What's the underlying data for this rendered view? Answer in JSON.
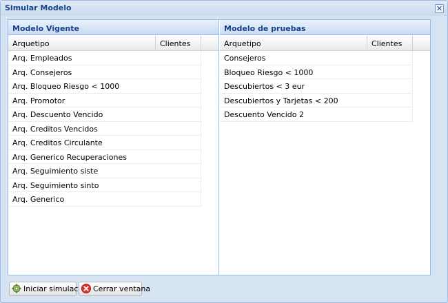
{
  "window": {
    "title": "Simular Modelo",
    "close_glyph": "✕"
  },
  "left_panel": {
    "title": "Modelo Vigente",
    "columns": [
      "Arquetipo",
      "Clientes"
    ],
    "rows": [
      "Arq. Empleados",
      "Arq. Consejeros",
      "Arq. Bloqueo Riesgo < 1000",
      "Arq. Promotor",
      "Arq. Descuento Vencido",
      "Arq. Creditos Vencidos",
      "Arq. Creditos Circulante",
      "Arq. Generico Recuperaciones",
      "Arq. Seguimiento siste",
      "Arq. Seguimiento sinto",
      "Arq. Generico"
    ]
  },
  "right_panel": {
    "title": "Modelo de pruebas",
    "columns": [
      "Arquetipo",
      "Clientes"
    ],
    "rows": [
      "Consejeros",
      "Bloqueo Riesgo < 1000",
      "Descubiertos < 3 eur",
      "Descubiertos y Tarjetas < 200",
      "Descuento Vencido 2"
    ]
  },
  "footer": {
    "start_label": "Iniciar simulación",
    "start_icon": "gear-icon",
    "close_label": "Cerrar ventana",
    "close_icon": "cancel-icon"
  }
}
